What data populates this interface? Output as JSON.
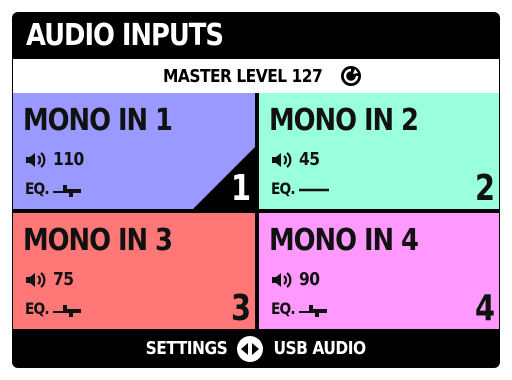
{
  "title": "AUDIO INPUTS",
  "master": {
    "label": "MASTER LEVEL 127",
    "icon": "refresh-icon"
  },
  "colors": {
    "background": "#000000",
    "tile1": "#9999ff",
    "tile2": "#99ffdd",
    "tile3": "#ff7777",
    "tile4": "#ff99ff"
  },
  "inputs": [
    {
      "name": "MONO IN 1",
      "volume": "110",
      "eq_label": "EQ.",
      "eq_icon": "eq-curve-icon",
      "channel": "1",
      "selected": true
    },
    {
      "name": "MONO IN 2",
      "volume": "45",
      "eq_label": "EQ.",
      "eq_icon": "eq-flat-icon",
      "channel": "2",
      "selected": false
    },
    {
      "name": "MONO IN 3",
      "volume": "75",
      "eq_label": "EQ.",
      "eq_icon": "eq-curve-icon",
      "channel": "3",
      "selected": false
    },
    {
      "name": "MONO IN 4",
      "volume": "90",
      "eq_label": "EQ.",
      "eq_icon": "eq-curve-icon",
      "channel": "4",
      "selected": false
    }
  ],
  "footer": {
    "left": "SETTINGS",
    "right": "USB AUDIO",
    "icon": "left-right-arrows-icon"
  }
}
